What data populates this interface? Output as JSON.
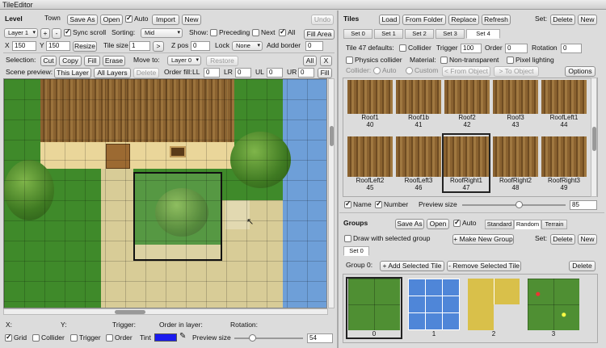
{
  "window_title": "TileEditor",
  "level": {
    "title": "Level",
    "name": "Town",
    "save_as": "Save As",
    "open": "Open",
    "auto_label": "Auto",
    "import": "Import",
    "new": "New",
    "undo": "Undo",
    "layer_select": "Layer 1",
    "plus": "+",
    "minus": "-",
    "sync_scroll": "Sync scroll",
    "sorting_label": "Sorting:",
    "sorting_value": "Mid",
    "show_label": "Show:",
    "preceding": "Preceding",
    "next": "Next",
    "all_label": "All",
    "fill_area": "Fill Area",
    "x_label": "X",
    "x_value": "150",
    "y_label": "Y",
    "y_value": "150",
    "resize": "Resize",
    "tile_size_label": "Tile size",
    "tile_size_value": "1",
    "arrow": ">",
    "zpos_label": "Z pos",
    "zpos_value": "0",
    "lock_label": "Lock",
    "lock_value": "None",
    "add_border_label": "Add border",
    "add_border_value": "0",
    "selection_label": "Selection:",
    "cut": "Cut",
    "copy": "Copy",
    "fill": "Fill",
    "erase": "Erase",
    "move_to_label": "Move to:",
    "move_to_value": "Layer 0",
    "restore": "Restore",
    "all_btn": "All",
    "x_btn": "X",
    "scene_preview_label": "Scene preview:",
    "this_layer": "This Layer",
    "all_layers": "All Layers",
    "delete": "Delete",
    "order_fill_label": "Order fill:",
    "ll_label": "LL",
    "ll_value": "0",
    "lr_label": "LR",
    "lr_value": "0",
    "ul_label": "UL",
    "ul_value": "0",
    "ur_label": "UR",
    "ur_value": "0",
    "fill_btn2": "Fill"
  },
  "status": {
    "x": "X:",
    "y": "Y:",
    "trigger": "Trigger:",
    "order_in_layer": "Order in layer:",
    "rotation": "Rotation:"
  },
  "bottom": {
    "grid": "Grid",
    "collider": "Collider",
    "trigger": "Trigger",
    "order": "Order",
    "tint": "Tint",
    "preview_size": "Preview size",
    "preview_value": "54",
    "tint_color": "#1a1aee"
  },
  "tiles": {
    "title": "Tiles",
    "load": "Load",
    "from_folder": "From Folder",
    "replace": "Replace",
    "refresh": "Refresh",
    "set_label": "Set:",
    "delete": "Delete",
    "new": "New",
    "sets": [
      "Set 0",
      "Set 1",
      "Set 2",
      "Set 3",
      "Set 4"
    ],
    "defaults_label": "Tile 47 defaults:",
    "collider": "Collider",
    "trigger_label": "Trigger",
    "trigger_value": "100",
    "order_label": "Order",
    "order_value": "0",
    "rotation_label": "Rotation",
    "rotation_value": "0",
    "physics_collider": "Physics collider",
    "material_label": "Material:",
    "non_transparent": "Non-transparent",
    "pixel_lighting": "Pixel lighting",
    "collider_label": "Collider:",
    "auto": "Auto",
    "custom": "Custom",
    "from_object_left": "< From Object",
    "to_object": "> To Object",
    "options": "Options",
    "items": [
      {
        "name": "Roof1",
        "num": "40"
      },
      {
        "name": "Roof1b",
        "num": "41"
      },
      {
        "name": "Roof2",
        "num": "42"
      },
      {
        "name": "Roof3",
        "num": "43"
      },
      {
        "name": "RoofLeft1",
        "num": "44"
      },
      {
        "name": "RoofLeft2",
        "num": "45"
      },
      {
        "name": "RoofLeft3",
        "num": "46"
      },
      {
        "name": "RoofRight1",
        "num": "47"
      },
      {
        "name": "RoofRight2",
        "num": "48"
      },
      {
        "name": "RoofRight3",
        "num": "49"
      }
    ],
    "name_chk": "Name",
    "number_chk": "Number",
    "preview_size": "Preview size",
    "preview_value": "85"
  },
  "groups": {
    "title": "Groups",
    "save_as": "Save As",
    "open": "Open",
    "auto": "Auto",
    "standard": "Standard",
    "random": "Random",
    "terrain": "Terrain",
    "draw_with_selected": "Draw with selected group",
    "make_new_group": "+ Make New Group",
    "set_label": "Set:",
    "delete": "Delete",
    "new": "New",
    "set_tab": "Set 0",
    "group_label": "Group 0:",
    "add_selected": "+ Add Selected Tile",
    "remove_selected": "- Remove Selected Tile",
    "delete2": "Delete",
    "items": [
      "0",
      "1",
      "2",
      "3"
    ]
  }
}
